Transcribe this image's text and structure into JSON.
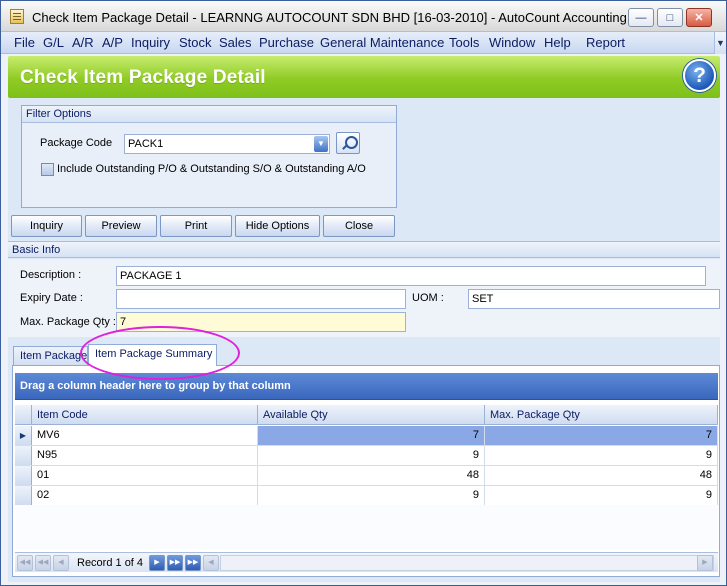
{
  "window": {
    "title": "Check Item Package Detail - LEARNNG AUTOCOUNT SDN BHD [16-03-2010] - AutoCount Accounting (...",
    "minimize": "—",
    "maximize": "□",
    "close": "✕"
  },
  "menu": [
    "File",
    "G/L",
    "A/R",
    "A/P",
    "Inquiry",
    "Stock",
    "Sales",
    "Purchase",
    "General Maintenance",
    "Tools",
    "Window",
    "Help",
    "Report"
  ],
  "header": {
    "title": "Check Item Package Detail",
    "help": "?"
  },
  "filter": {
    "group_title": "Filter Options",
    "package_code_label": "Package Code",
    "package_code_value": "PACK1",
    "include_outstanding_label": "Include Outstanding P/O & Outstanding S/O & Outstanding A/O"
  },
  "buttons": {
    "inquiry": "Inquiry",
    "preview": "Preview",
    "print": "Print",
    "hide_options": "Hide Options",
    "close": "Close"
  },
  "basic_info": {
    "title": "Basic Info",
    "description_label": "Description :",
    "description_value": "PACKAGE 1",
    "expiry_label": "Expiry Date :",
    "expiry_value": "",
    "uom_label": "UOM :",
    "uom_value": "SET",
    "max_qty_label": "Max. Package Qty :",
    "max_qty_value": "7"
  },
  "tabs": [
    "Item Package",
    "Item Package Summary"
  ],
  "grid": {
    "group_hint": "Drag a column header here to group by that column",
    "columns": [
      "Item Code",
      "Available Qty",
      "Max. Package Qty"
    ],
    "rows": [
      [
        "MV6",
        "7",
        "7"
      ],
      [
        "N95",
        "9",
        "9"
      ],
      [
        "01",
        "48",
        "48"
      ],
      [
        "02",
        "9",
        "9"
      ]
    ]
  },
  "navigator": {
    "record_text": "Record 1 of 4"
  },
  "colors": {
    "header_green": "#8fcb24",
    "selection_blue": "#8aa7e6",
    "highlight_ring": "#e020dc"
  }
}
